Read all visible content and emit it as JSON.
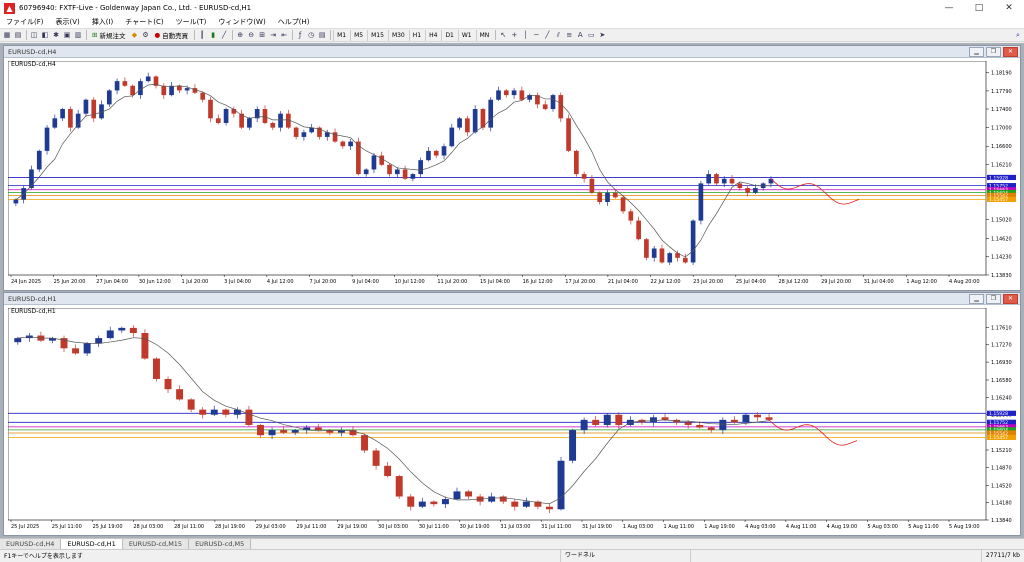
{
  "app": {
    "title": "60796940: FXTF-Live - Goldenway Japan Co., Ltd. - EURUSD-cd,H1",
    "icon": "MT4-logo"
  },
  "menu": [
    "ファイル(F)",
    "表示(V)",
    "挿入(I)",
    "チャート(C)",
    "ツール(T)",
    "ウィンドウ(W)",
    "ヘルプ(H)"
  ],
  "toolbar": {
    "new_order": "新規注文",
    "auto_trade": "自動売買",
    "timeframes": [
      "M1",
      "M5",
      "M15",
      "M30",
      "H1",
      "H4",
      "D1",
      "W1",
      "MN"
    ]
  },
  "charts": {
    "top": {
      "window_title": "EURUSD-cd,H4",
      "symbol_label": "EURUSD-cd,H4"
    },
    "bottom": {
      "window_title": "EURUSD-cd,H1",
      "symbol_label": "EURUSD-cd,H1"
    }
  },
  "chart_data": [
    {
      "type": "candlestick",
      "title": "EURUSD-cd,H4",
      "y_ticks": [
        "1.18190",
        "1.17790",
        "1.17400",
        "1.17000",
        "1.16600",
        "1.16210",
        "1.15020",
        "1.14620",
        "1.14230",
        "1.13830"
      ],
      "ylim": [
        1.1383,
        1.1839
      ],
      "x_ticks": [
        "24 Jun 2025",
        "25 Jun 20:00",
        "27 Jun 04:00",
        "30 Jun 12:00",
        "1 Jul 20:00",
        "3 Jul 04:00",
        "4 Jul 12:00",
        "7 Jul 20:00",
        "9 Jul 04:00",
        "10 Jul 12:00",
        "11 Jul 20:00",
        "15 Jul 04:00",
        "16 Jul 12:00",
        "17 Jul 20:00",
        "21 Jul 04:00",
        "22 Jul 12:00",
        "23 Jul 20:00",
        "25 Jul 04:00",
        "28 Jul 12:00",
        "29 Jul 20:00",
        "31 Jul 04:00",
        "1 Aug 12:00",
        "4 Aug 20:00"
      ],
      "price_levels": [
        {
          "label": "1.15928",
          "value": 1.15928,
          "color": "#2020c8"
        },
        {
          "label": "1.15752",
          "value": 1.15752,
          "color": "#2020c8"
        },
        {
          "label": "1.15663",
          "value": 1.15663,
          "color": "#c000c0"
        },
        {
          "label": "1.15604",
          "value": 1.15604,
          "color": "#20a020"
        },
        {
          "label": "1.15542",
          "value": 1.15542,
          "color": "#e08000"
        },
        {
          "label": "1.15457",
          "value": 1.15457,
          "color": "#f0a000"
        }
      ],
      "closes": [
        1.1545,
        1.157,
        1.161,
        1.165,
        1.17,
        1.172,
        1.174,
        1.17,
        1.173,
        1.176,
        1.172,
        1.175,
        1.178,
        1.18,
        1.179,
        1.177,
        1.18,
        1.181,
        1.179,
        1.177,
        1.179,
        1.178,
        1.1785,
        1.1775,
        1.176,
        1.172,
        1.171,
        1.174,
        1.173,
        1.17,
        1.172,
        1.174,
        1.171,
        1.17,
        1.173,
        1.17,
        1.168,
        1.169,
        1.17,
        1.168,
        1.169,
        1.167,
        1.166,
        1.167,
        1.16,
        1.161,
        1.164,
        1.162,
        1.16,
        1.161,
        1.159,
        1.16,
        1.163,
        1.165,
        1.164,
        1.166,
        1.17,
        1.172,
        1.169,
        1.174,
        1.17,
        1.176,
        1.178,
        1.177,
        1.178,
        1.176,
        1.177,
        1.175,
        1.174,
        1.177,
        1.172,
        1.165,
        1.16,
        1.159,
        1.156,
        1.154,
        1.156,
        1.155,
        1.152,
        1.15,
        1.146,
        1.142,
        1.144,
        1.141,
        1.143,
        1.142,
        1.141,
        1.15,
        1.158,
        1.16,
        1.158,
        1.159,
        1.158,
        1.157,
        1.156,
        1.157,
        1.158,
        1.159
      ]
    },
    {
      "type": "candlestick",
      "title": "EURUSD-cd,H1",
      "y_ticks": [
        "1.17610",
        "1.17270",
        "1.16930",
        "1.16580",
        "1.16240",
        "1.15900",
        "1.15210",
        "1.14870",
        "1.14520",
        "1.14180",
        "1.13840"
      ],
      "ylim": [
        1.1384,
        1.1795
      ],
      "x_ticks": [
        "25 Jul 2025",
        "25 Jul 11:00",
        "25 Jul 19:00",
        "28 Jul 03:00",
        "28 Jul 11:00",
        "28 Jul 19:00",
        "29 Jul 03:00",
        "29 Jul 11:00",
        "29 Jul 19:00",
        "30 Jul 03:00",
        "30 Jul 11:00",
        "30 Jul 19:00",
        "31 Jul 03:00",
        "31 Jul 11:00",
        "31 Jul 19:00",
        "1 Aug 03:00",
        "1 Aug 11:00",
        "1 Aug 19:00",
        "4 Aug 03:00",
        "4 Aug 11:00",
        "4 Aug 19:00",
        "5 Aug 03:00",
        "5 Aug 11:00",
        "5 Aug 19:00"
      ],
      "price_levels": [
        {
          "label": "1.15928",
          "value": 1.15928,
          "color": "#2020c8"
        },
        {
          "label": "1.15752",
          "value": 1.15752,
          "color": "#2020c8"
        },
        {
          "label": "1.15663",
          "value": 1.15663,
          "color": "#c000c0"
        },
        {
          "label": "1.15604",
          "value": 1.15604,
          "color": "#20a020"
        },
        {
          "label": "1.15542",
          "value": 1.15542,
          "color": "#e08000"
        },
        {
          "label": "1.15457",
          "value": 1.15457,
          "color": "#f0a000"
        }
      ],
      "closes": [
        1.174,
        1.1745,
        1.1735,
        1.174,
        1.172,
        1.171,
        1.173,
        1.174,
        1.1755,
        1.176,
        1.175,
        1.17,
        1.166,
        1.164,
        1.162,
        1.16,
        1.159,
        1.16,
        1.159,
        1.16,
        1.157,
        1.155,
        1.156,
        1.1555,
        1.156,
        1.1565,
        1.156,
        1.1555,
        1.156,
        1.155,
        1.152,
        1.149,
        1.147,
        1.143,
        1.141,
        1.142,
        1.1415,
        1.1425,
        1.144,
        1.143,
        1.142,
        1.143,
        1.142,
        1.141,
        1.142,
        1.141,
        1.1405,
        1.15,
        1.156,
        1.158,
        1.157,
        1.159,
        1.157,
        1.158,
        1.1575,
        1.1585,
        1.158,
        1.1575,
        1.157,
        1.1565,
        1.156,
        1.158,
        1.1575,
        1.159,
        1.1585,
        1.158
      ]
    }
  ],
  "tabs": [
    "EURUSD-cd,H4",
    "EURUSD-cd,H1",
    "EURUSD-cd,M15",
    "EURUSD-cd,M5"
  ],
  "active_tab": 1,
  "status": {
    "help": "F1キーでヘルプを表示します",
    "profile": "ワードネル",
    "kb": "27711/7 kb"
  }
}
